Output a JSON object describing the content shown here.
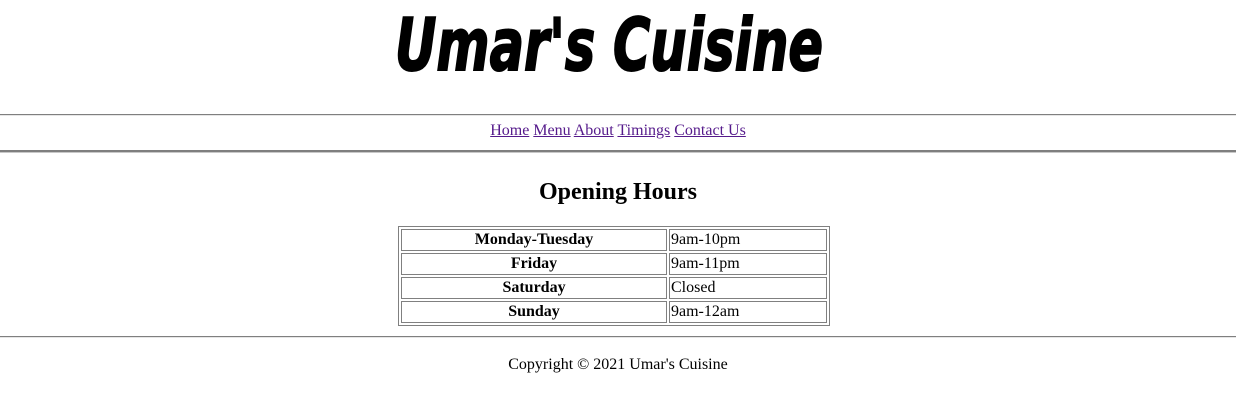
{
  "logo": {
    "text": "Umar's Cuisine"
  },
  "nav": {
    "items": [
      {
        "label": "Home"
      },
      {
        "label": "Menu"
      },
      {
        "label": "About"
      },
      {
        "label": "Timings"
      },
      {
        "label": "Contact Us"
      }
    ],
    "link_color": "#551a8b"
  },
  "main": {
    "heading": "Opening Hours",
    "hours": [
      {
        "day": "Monday-Tuesday",
        "time": "9am-10pm"
      },
      {
        "day": "Friday",
        "time": "9am-11pm"
      },
      {
        "day": "Saturday",
        "time": "Closed"
      },
      {
        "day": "Sunday",
        "time": "9am-12am"
      }
    ]
  },
  "footer": {
    "copyright": "Copyright © 2021 Umar's Cuisine"
  }
}
